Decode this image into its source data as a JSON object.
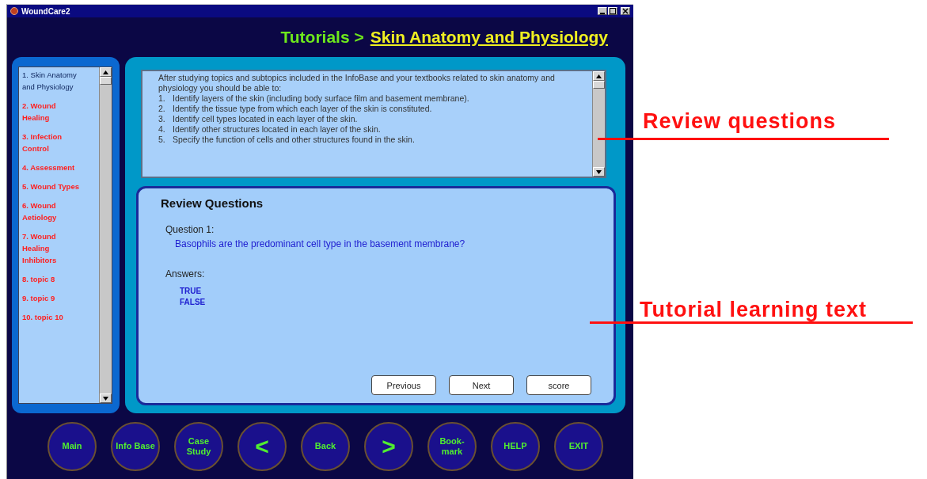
{
  "window": {
    "title": "WoundCare2"
  },
  "header": {
    "section": "Tutorials >",
    "topic": "Skin Anatomy and Physiology"
  },
  "sidebar": {
    "items": [
      {
        "label": "1.  Skin Anatomy and Physiology",
        "selected": true
      },
      {
        "label": "2.  Wound Healing",
        "selected": false
      },
      {
        "label": "3. Infection Control",
        "selected": false
      },
      {
        "label": "4. Assessment",
        "selected": false
      },
      {
        "label": "5. Wound Types",
        "selected": false
      },
      {
        "label": "6. Wound Aetiology",
        "selected": false
      },
      {
        "label": "7. Wound Healing Inhibitors",
        "selected": false
      },
      {
        "label": "8. topic 8",
        "selected": false
      },
      {
        "label": "9. topic 9",
        "selected": false
      },
      {
        "label": "10. topic 10",
        "selected": false
      }
    ]
  },
  "objectives": {
    "intro": "After studying topics and subtopics included in the InfoBase and your textbooks related to skin anatomy and physiology you should be able to:",
    "items": [
      {
        "number": "1.",
        "text": "Identify layers of the skin (including body surface film and basement membrane)."
      },
      {
        "number": "2.",
        "text": "Identify the tissue type from which each layer of the skin is constituted."
      },
      {
        "number": "3.",
        "text": "Identify cell types located in each layer of the skin."
      },
      {
        "number": "4.",
        "text": "Identify other structures located in each layer of the skin."
      },
      {
        "number": "5.",
        "text": "Specify the function of cells and other structures found in the skin."
      }
    ]
  },
  "review": {
    "title": "Review Questions",
    "question_label": "Question 1:",
    "question": "Basophils are the predominant cell type in the basement membrane?",
    "answers_label": "Answers:",
    "answers": [
      "TRUE",
      "FALSE"
    ],
    "buttons": [
      "Previous",
      "Next",
      "score"
    ]
  },
  "nav_buttons": [
    {
      "kind": "text",
      "label": "Main"
    },
    {
      "kind": "text",
      "label": "Info Base"
    },
    {
      "kind": "text",
      "label": "Case Study"
    },
    {
      "kind": "arrow",
      "label": "<"
    },
    {
      "kind": "text",
      "label": "Back"
    },
    {
      "kind": "arrow",
      "label": ">"
    },
    {
      "kind": "text",
      "label": "Book-mark"
    },
    {
      "kind": "text",
      "label": "HELP"
    },
    {
      "kind": "text",
      "label": "EXIT"
    }
  ],
  "annotations": [
    {
      "label": "Review questions"
    },
    {
      "label": "Tutorial learning text"
    }
  ]
}
